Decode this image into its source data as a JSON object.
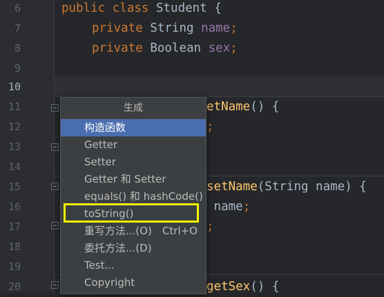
{
  "editor": {
    "line_numbers": [
      "6",
      "7",
      "8",
      "9",
      "10",
      "11",
      "12",
      "13",
      "14",
      "15",
      "16",
      "17",
      "18",
      "19",
      "20"
    ],
    "lines": {
      "l6": {
        "kw": "public class",
        "name": "Student",
        "brace": "{"
      },
      "l7": {
        "kw": "private",
        "type": "String",
        "field": "name",
        "semi": ";"
      },
      "l8": {
        "kw": "private",
        "type": "Boolean",
        "field": "sex",
        "semi": ";"
      },
      "l11": {
        "method": "etName",
        "parens": "()",
        "brace": "{"
      },
      "l12": {
        "semi": ";"
      },
      "l15": {
        "method": "setName",
        "params": "(String name)",
        "brace": "{"
      },
      "l16": {
        "text": "name",
        "semi": ";"
      },
      "l17": {
        "semi": ";"
      },
      "l20": {
        "method": "getSex",
        "parens": "()",
        "brace": "{"
      }
    }
  },
  "generate_menu": {
    "title": "生成",
    "items": [
      {
        "label": "构造函数",
        "selected": true
      },
      {
        "label": "Getter"
      },
      {
        "label": "Setter"
      },
      {
        "label": "Getter 和 Setter"
      },
      {
        "label": "equals() 和 hashCode()"
      },
      {
        "label": "toString()",
        "highlighted": true
      },
      {
        "label": "重写方法...(O)",
        "shortcut": "Ctrl+O"
      },
      {
        "label": "委托方法...(D)"
      },
      {
        "label": "Test..."
      },
      {
        "label": "Copyright"
      }
    ]
  },
  "colors": {
    "background": "#25272a",
    "keyword": "#cc7832",
    "field": "#9876aa",
    "method": "#ffc66d",
    "selection": "#4b6eaf",
    "highlight_box": "#f5f500"
  }
}
